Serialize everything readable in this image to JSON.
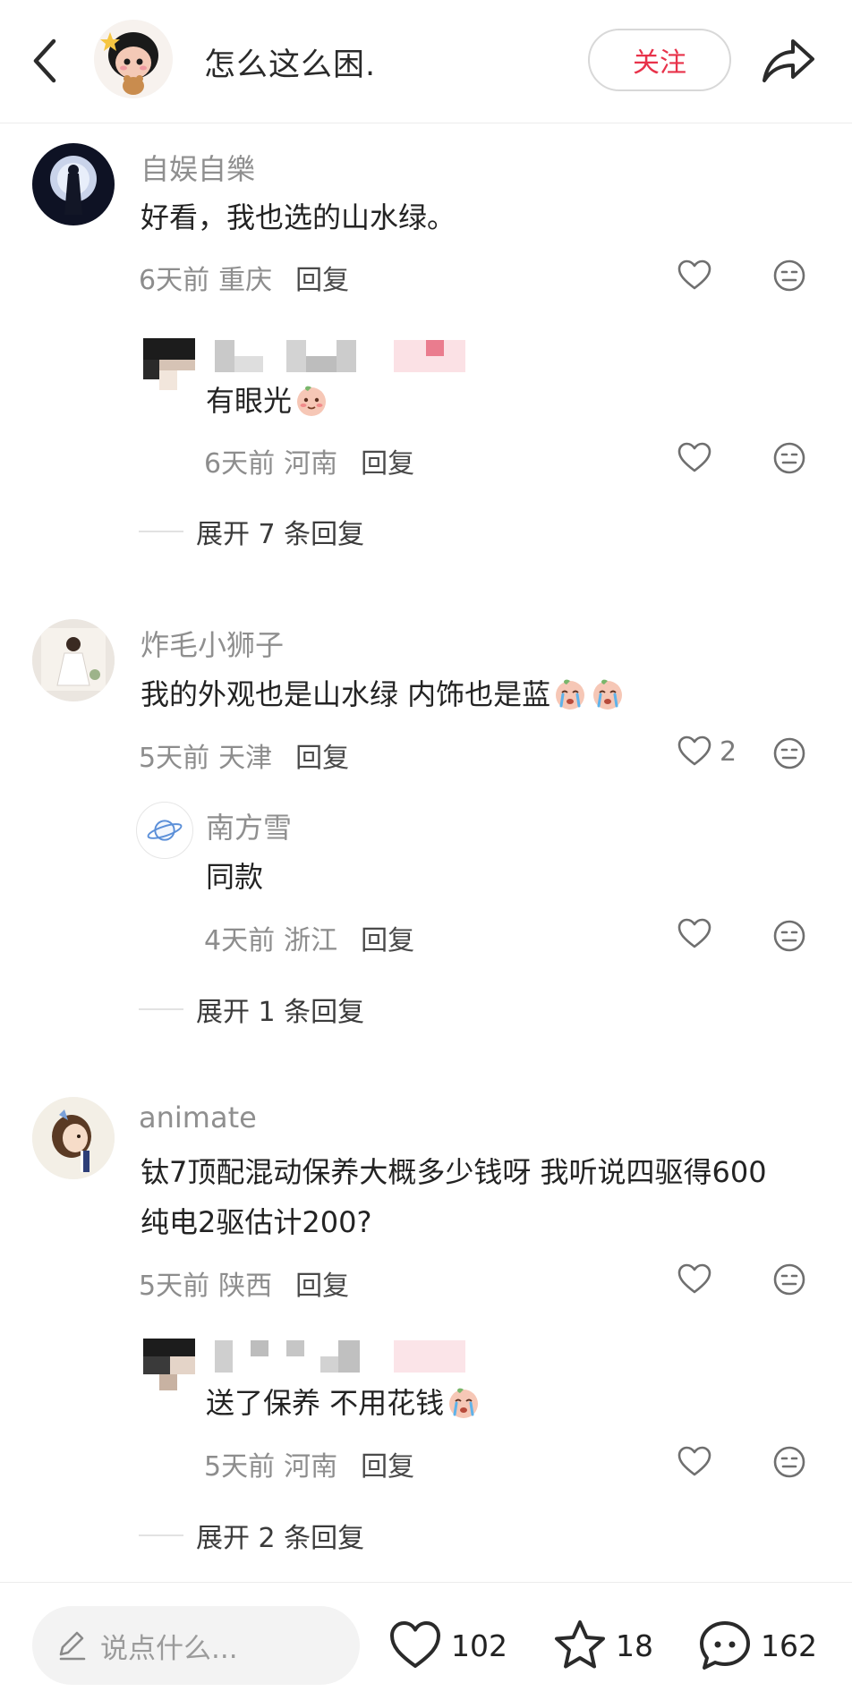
{
  "header": {
    "back_icon": "chevron-left-icon",
    "author_name": "怎么这么困.",
    "follow_label": "关注",
    "share_icon": "share-arrow-icon",
    "accent_color": "#e8324a"
  },
  "comments": [
    {
      "user": "自娱自樂",
      "text": "好看，我也选的山水绿。",
      "time": "6天前",
      "location": "重庆",
      "reply_label": "回复",
      "reply": {
        "text": "有眼光",
        "emoji": "blushing-emoji",
        "time": "6天前",
        "location": "河南",
        "reply_label": "回复"
      },
      "expand_label": "展开 7 条回复"
    },
    {
      "user": "炸毛小狮子",
      "text": "我的外观也是山水绿 内饰也是蓝",
      "emojis": [
        "crying-emoji",
        "crying-emoji"
      ],
      "time": "5天前",
      "location": "天津",
      "reply_label": "回复",
      "likes": "2",
      "reply": {
        "user": "南方雪",
        "text": "同款",
        "time": "4天前",
        "location": "浙江",
        "reply_label": "回复"
      },
      "expand_label": "展开 1 条回复"
    },
    {
      "user": "animate",
      "text_line1": "钛7顶配混动保养大概多少钱呀 我听说四驱得600",
      "text_line2": "纯电2驱估计200?",
      "time": "5天前",
      "location": "陕西",
      "reply_label": "回复",
      "reply": {
        "text": "送了保养 不用花钱",
        "emoji": "crying-emoji",
        "time": "5天前",
        "location": "河南",
        "reply_label": "回复"
      },
      "expand_label": "展开 2 条回复"
    }
  ],
  "bottom_bar": {
    "input_placeholder": "说点什么...",
    "like_count": "102",
    "star_count": "18",
    "comment_count": "162"
  }
}
